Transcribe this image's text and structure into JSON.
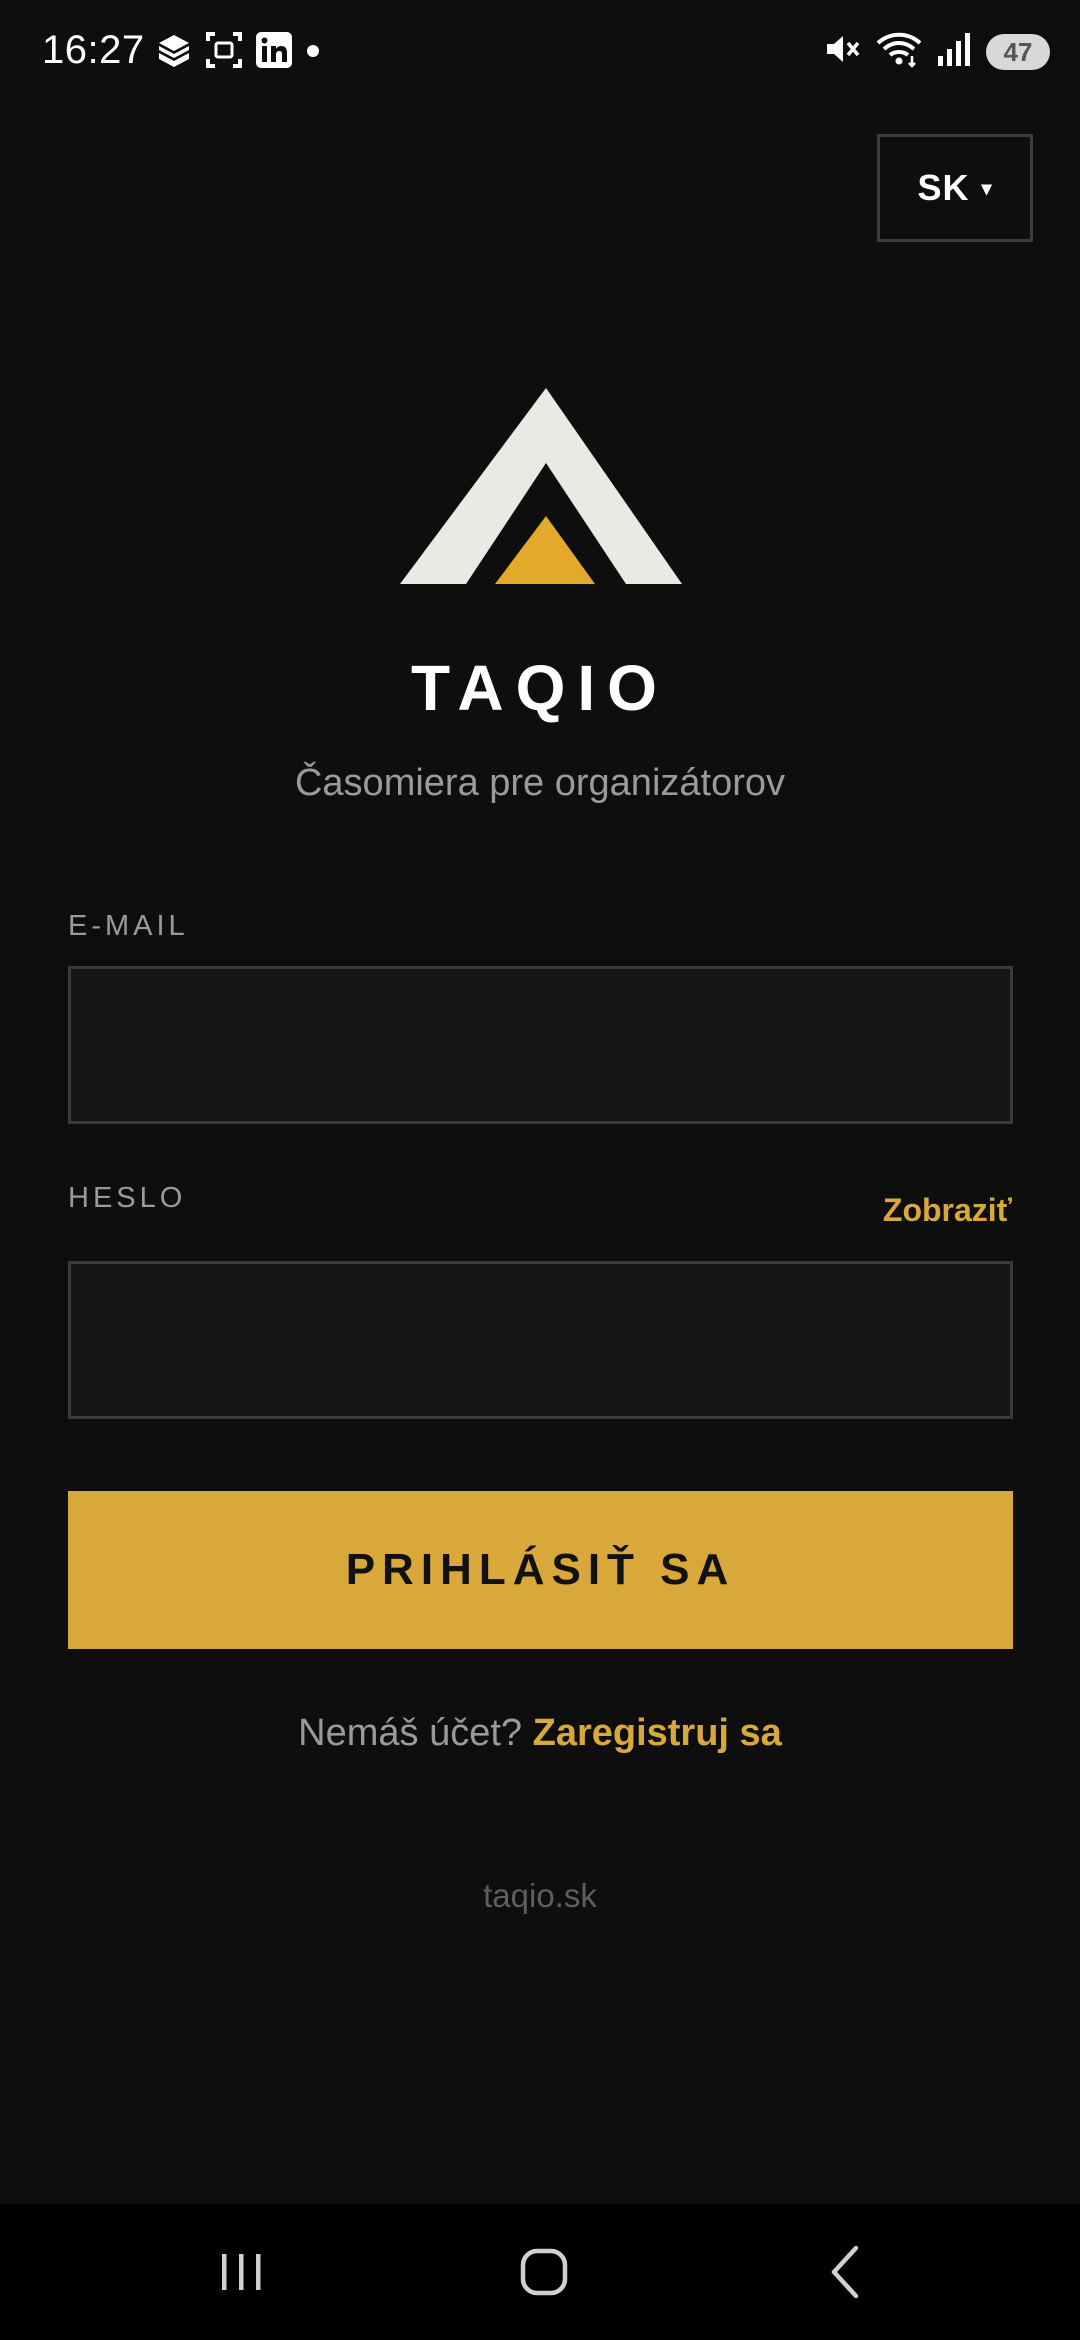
{
  "status_bar": {
    "time": "16:27",
    "battery": "47",
    "left_icons": [
      "stack-icon",
      "screenshot-icon",
      "linkedin-icon",
      "dot-icon"
    ],
    "right_icons": [
      "mute-icon",
      "wifi-icon",
      "signal-icon",
      "battery-icon"
    ]
  },
  "language": {
    "selected": "SK",
    "caret": "▾"
  },
  "brand": {
    "name": "TAQIO",
    "tagline": "Časomiera pre organizátorov",
    "logo_colors": {
      "outer": "#ebe9e3",
      "inner": "#e2a92b"
    }
  },
  "form": {
    "email_label": "E-MAIL",
    "email_value": "",
    "password_label": "HESLO",
    "password_value": "",
    "show_password": "Zobraziť",
    "login_button": "PRIHLÁSIŤ SA"
  },
  "register": {
    "prompt": "Nemáš účet?",
    "link": "Zaregistruj sa"
  },
  "footer": {
    "url": "taqio.sk"
  },
  "colors": {
    "background": "#0e0e0e",
    "accent": "#d9a83a",
    "muted_text": "#9a9a9a"
  },
  "nav_bar": {
    "icons": [
      "recents-icon",
      "home-icon",
      "back-icon"
    ]
  }
}
